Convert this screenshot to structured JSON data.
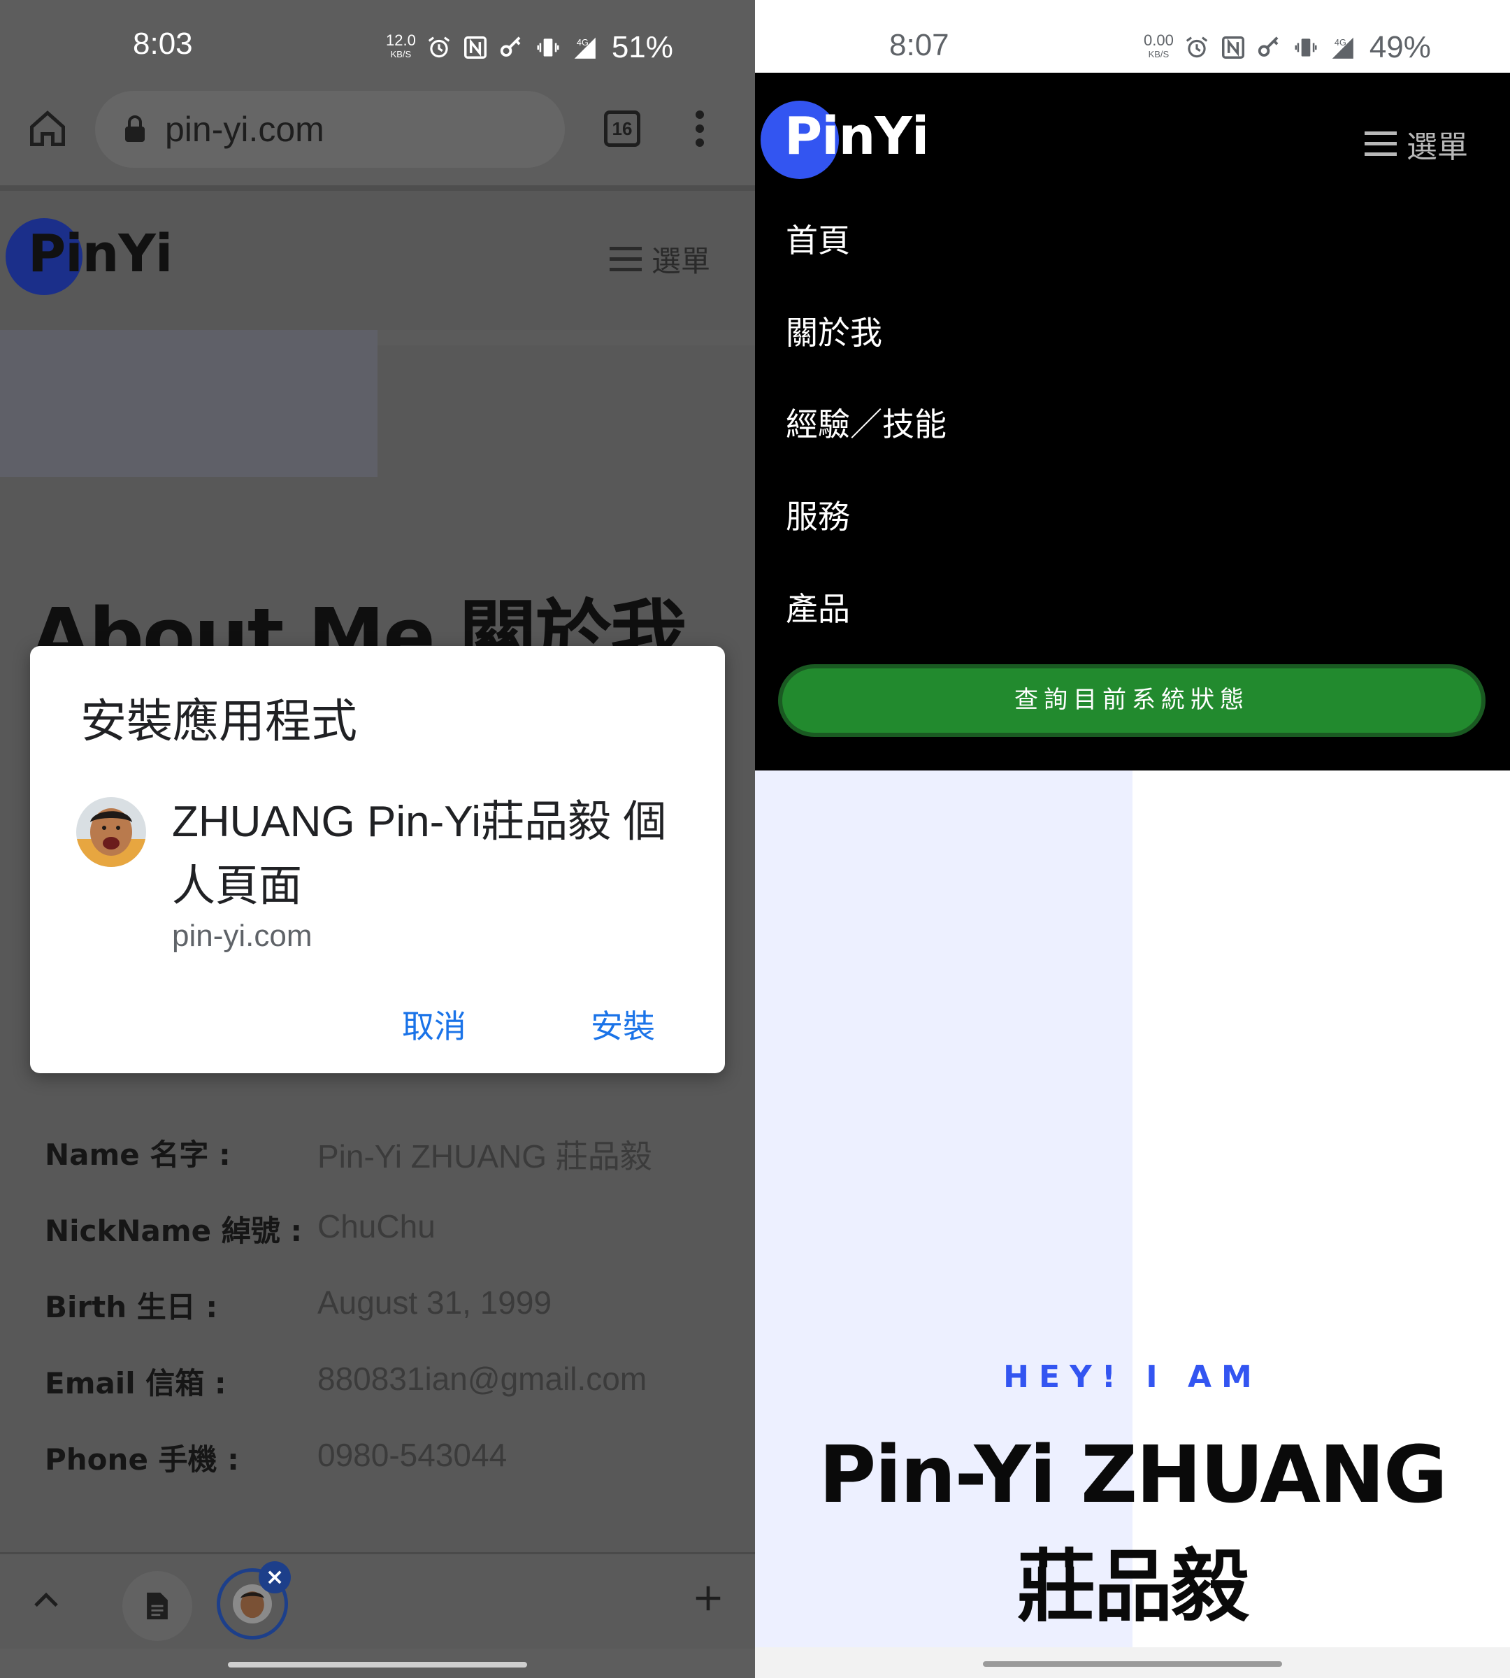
{
  "left": {
    "status_bar": {
      "time": "8:03",
      "speed_value": "12.0",
      "speed_unit": "KB/S",
      "network": "4G",
      "battery": "51%"
    },
    "browser": {
      "url": "pin-yi.com",
      "tab_count": "16"
    },
    "site": {
      "logo": "PinYi",
      "menu_label": "選單",
      "heading": "About Me 關於我",
      "info": [
        {
          "key": "Name 名字 :",
          "value": "Pin-Yi ZHUANG 莊品毅"
        },
        {
          "key": "NickName 綽號 :",
          "value": "ChuChu"
        },
        {
          "key": "Birth 生日 :",
          "value": "August 31, 1999"
        },
        {
          "key": "Email 信箱 :",
          "value": "880831ian@gmail.com"
        },
        {
          "key": "Phone 手機 :",
          "value": "0980-543044"
        }
      ]
    },
    "dialog": {
      "title": "安裝應用程式",
      "app_name": "ZHUANG Pin-Yi莊品毅 個人頁面",
      "host": "pin-yi.com",
      "cancel_label": "取消",
      "install_label": "安裝"
    },
    "bottom_bar": {
      "close_badge": "×",
      "plus_label": "+"
    }
  },
  "right": {
    "status_bar": {
      "time": "8:07",
      "speed_value": "0.00",
      "speed_unit": "KB/S",
      "network": "4G",
      "battery": "49%"
    },
    "site": {
      "logo": "PinYi",
      "menu_label": "選單",
      "nav": [
        "首頁",
        "關於我",
        "經驗／技能",
        "服務",
        "產品"
      ],
      "status_button": "查詢目前系統狀態",
      "hero_kicker": "HEY! I AM",
      "hero_name_line1": "Pin-Yi ZHUANG",
      "hero_name_line2": "莊品毅"
    }
  },
  "colors": {
    "brand_blue": "#3355f1",
    "status_green": "#228a2e",
    "link_blue": "#1a73e8"
  }
}
